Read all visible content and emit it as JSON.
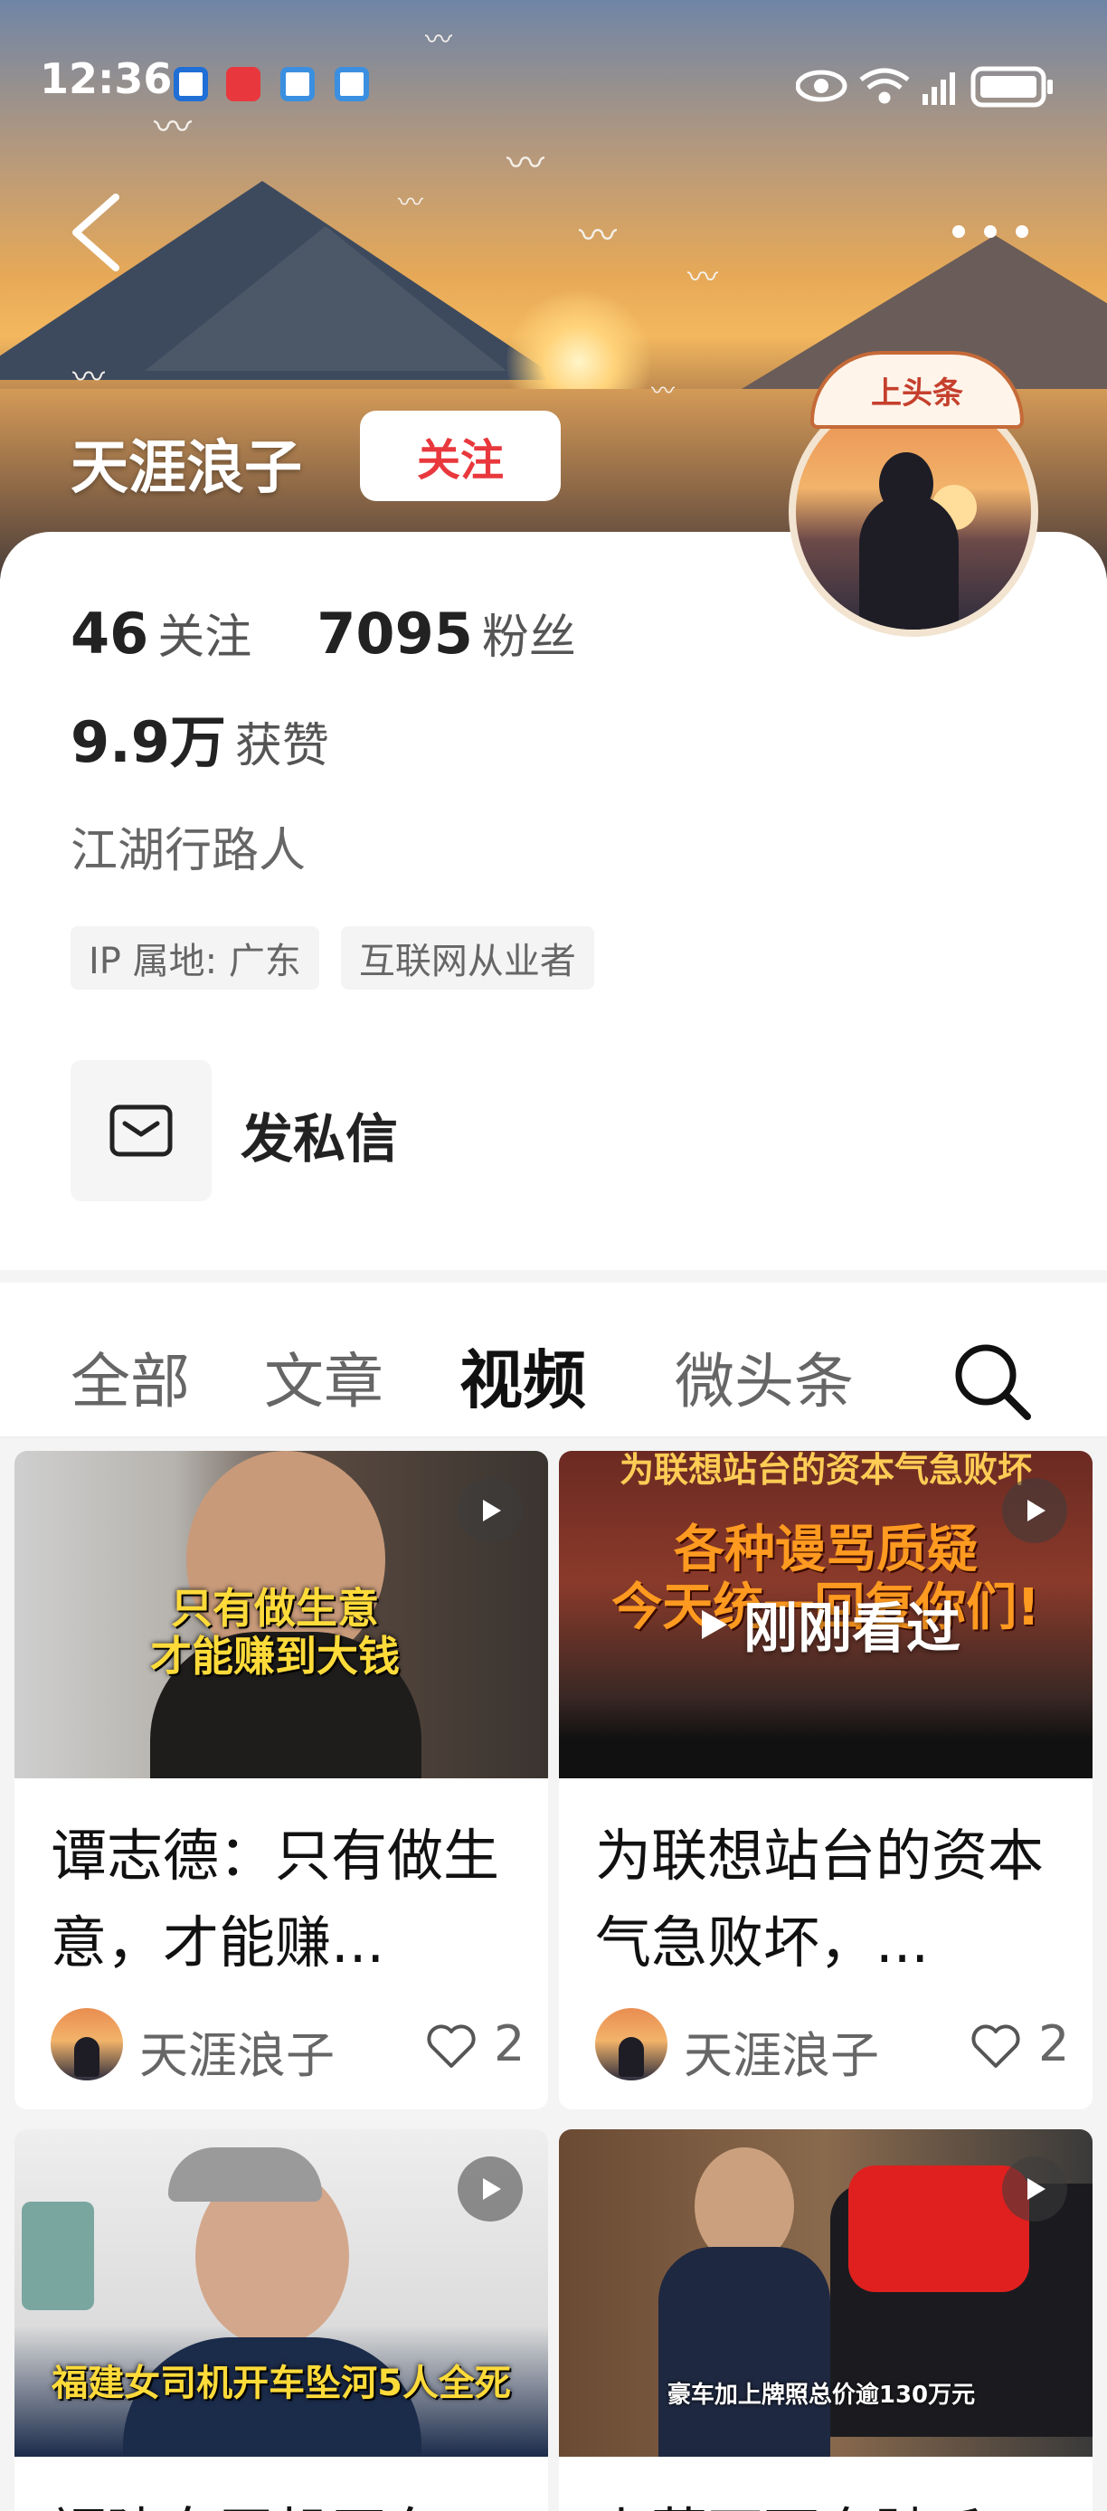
{
  "status_bar": {
    "time": "12:36"
  },
  "profile": {
    "name": "天涯浪子",
    "follow_label": "关注",
    "badge": "上头条",
    "following_count": "46",
    "following_label": "关注",
    "followers_count": "7095",
    "followers_label": "粉丝",
    "likes_count": "9.9万",
    "likes_label": "获赞",
    "bio": "江湖行路人",
    "tags": [
      "IP 属地: 广东",
      "互联网从业者"
    ],
    "dm_label": "发私信"
  },
  "tabs": [
    {
      "label": "全部"
    },
    {
      "label": "文章"
    },
    {
      "label": "视频"
    },
    {
      "label": "微头条"
    }
  ],
  "videos": [
    {
      "thumb_caption": "只有做生意\n才能赚到大钱",
      "title": "谭志德：只有做生意，才能赚...",
      "author": "天涯浪子",
      "likes": "2"
    },
    {
      "thumb_top": "为联想站台的资本气急败坏",
      "thumb_caption": "各种谩骂质疑\n今天统一回复你们!",
      "watched_label": "刚刚看过",
      "title": "为联想站台的资本气急败坏，...",
      "author": "天涯浪子",
      "likes": "2"
    },
    {
      "thumb_caption": "福建女司机开车坠河5人全死",
      "title": "福建女司机开车..."
    },
    {
      "thumb_caption": "豪车加上牌照总价逾130万元",
      "title": "上蔡石面奔驰丘..."
    }
  ],
  "colors": {
    "accent_red": "#e8383d",
    "caption_yellow": "#ffdb3a"
  }
}
